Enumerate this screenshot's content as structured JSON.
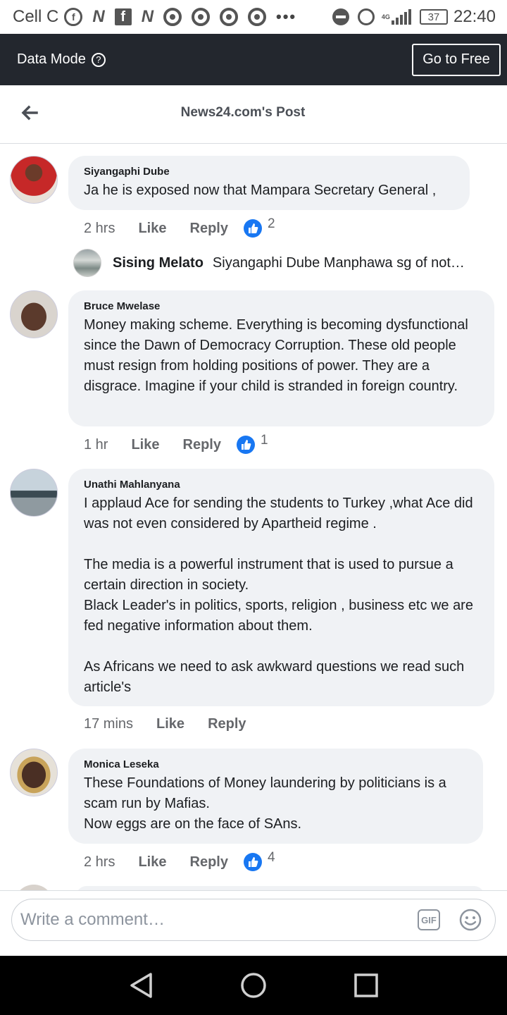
{
  "status_bar": {
    "carrier": "Cell C",
    "network_label": "4G",
    "battery": "37",
    "time": "22:40"
  },
  "data_mode": {
    "label": "Data Mode",
    "help": "?",
    "go_free": "Go to Free"
  },
  "header": {
    "title": "News24.com's Post"
  },
  "comments": [
    {
      "author": "Siyangaphi Dube",
      "text": "Ja he is exposed now that  Mampara Secretary General  ,",
      "time": "2 hrs",
      "like": "Like",
      "reply": "Reply",
      "likes": "2"
    },
    {
      "author": "Bruce Mwelase",
      "text": "Money making scheme. Everything is becoming dysfunctional since the Dawn of Democracy Corruption. These old people must resign from holding positions of power. They are a disgrace. Imagine if your child is stranded in foreign country.",
      "time": "1 hr",
      "like": "Like",
      "reply": "Reply",
      "likes": "1"
    },
    {
      "author": "Unathi Mahlanyana",
      "text": "I applaud Ace for sending the students to Turkey ,what Ace did  was not even considered by Apartheid regime .\n\nThe media is a powerful instrument that is used to  pursue a certain direction in society.\nBlack Leader's in politics, sports, religion  , business etc we are fed negative information about them.\n\nAs Africans we need to ask awkward questions we read such article's",
      "time": "17 mins",
      "like": "Like",
      "reply": "Reply"
    },
    {
      "author": "Monica Leseka",
      "text": "These Foundations of Money laundering by politicians is a scam run by Mafias.\nNow eggs are on the face of SAns.",
      "time": "2 hrs",
      "like": "Like",
      "reply": "Reply",
      "likes": "4"
    }
  ],
  "reply_preview": {
    "author": "Sising Melato",
    "text": "Siyangaphi Dube Manphawa sg of not…"
  },
  "composer": {
    "placeholder": "Write a comment…",
    "gif": "GIF"
  },
  "colors": {
    "accent": "#1877f2",
    "data_bar": "#23272e",
    "bubble": "#f0f2f5"
  }
}
